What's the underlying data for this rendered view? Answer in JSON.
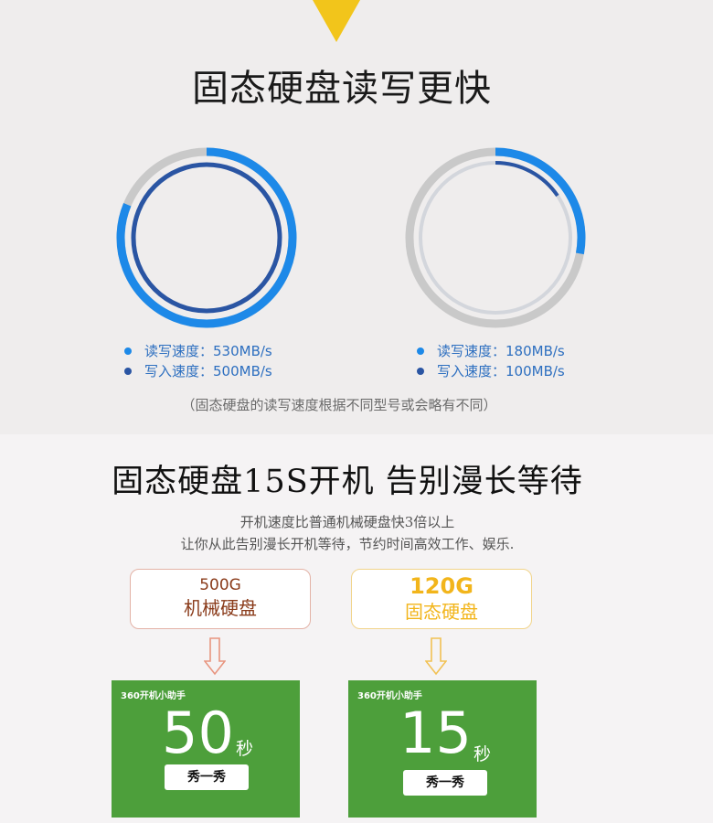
{
  "hero": {
    "title": "固态硬盘读写更快"
  },
  "rings": [
    {
      "read_label": "读写速度：530MB/s",
      "write_label": "写入速度：500MB/s"
    },
    {
      "read_label": "读写速度：180MB/s",
      "write_label": "写入速度：100MB/s"
    }
  ],
  "note": "（固态硬盘的读写速度根据不同型号或会略有不同）",
  "boot": {
    "title": "固态硬盘15S开机 告别漫长等待",
    "line1": "开机速度比普通机械硬盘快3倍以上",
    "line2": "让你从此告别漫长开机等待，节约时间高效工作、娱乐."
  },
  "compare": [
    {
      "capacity": "500G",
      "name": "机械硬盘",
      "color": "#8a3b1a",
      "border": "#e3b2a6"
    },
    {
      "capacity": "120G",
      "name": "固态硬盘",
      "color": "#f2b51b",
      "border": "#f1d48a"
    }
  ],
  "cards": [
    {
      "header": "360开机小助手",
      "number": "50",
      "unit": "秒",
      "button": "秀一秀"
    },
    {
      "header": "360开机小助手",
      "number": "15",
      "unit": "秒",
      "button": "秀一秀"
    }
  ],
  "colors": {
    "accent_blue": "#1d89e8",
    "dark_blue": "#2a55a3",
    "grey": "#c9c9c9",
    "green": "#4d9f3b",
    "yellow": "#f2c51b"
  }
}
